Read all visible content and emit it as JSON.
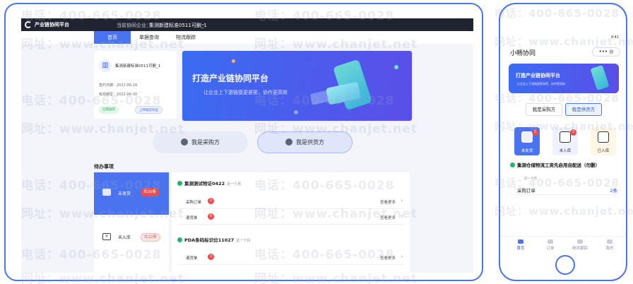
{
  "desktop": {
    "brand": "产业链协同平台",
    "enterprise_label": "当前协同企业：",
    "enterprise_value": "集测新建标准0511可删_1",
    "tabs": [
      "首页",
      "单据查询",
      "物流跟踪"
    ],
    "ent_card": {
      "name": "集测新建标准0511可删_1",
      "sign_date": "签约日期：2022-06-19",
      "expire_date": "有效期至：2022-06-30",
      "status_chip": "已配送货",
      "upload_chip": "上传收货凭证"
    },
    "banner": {
      "title": "打造产业链协同平台",
      "subtitle": "让企业上下游链接更紧密，协作更高效"
    },
    "roles": {
      "buyer": "我是采购方",
      "supplier": "我是供货方"
    },
    "todo": {
      "title": "待办事项",
      "tab_active": {
        "label": "未发货",
        "badge": "共20条"
      },
      "tab_inactive": {
        "label": "未入库",
        "badge": "共10条"
      },
      "groups": [
        {
          "title": "集测测试物证0422",
          "time": "近一个月",
          "rows": [
            {
              "label": "采购订单",
              "count": "2",
              "more": "查看更多"
            },
            {
              "label": "退货单",
              "count": "6",
              "more": "查看更多"
            }
          ]
        },
        {
          "title": "PDA条码标识位11027",
          "time": "近一个月",
          "rows": [
            {
              "label": "退货单",
              "count": "3",
              "more": "查看更多"
            }
          ]
        }
      ]
    }
  },
  "phone": {
    "time": "9:41",
    "title": "小畅协同",
    "menu": "••• ◎",
    "banner_title": "打造产业链协同平台",
    "banner_subtitle": "让企业上下游链接更紧密，协作更高效",
    "roles": {
      "buyer": "我是采购方",
      "supplier": "我是供货方"
    },
    "tiles": [
      {
        "label": "未发货",
        "badge": "2"
      },
      {
        "label": "未入库",
        "badge": "2"
      },
      {
        "label": "已入库"
      }
    ],
    "group_title": "集测仓储物流工资先启用自配送（勿删）",
    "group_time": "近一个月",
    "row_label": "采购订单",
    "row_value": "2条",
    "nav": [
      "首页",
      "订单",
      "物流跟踪",
      "我的"
    ]
  },
  "watermark": {
    "phone_line": "电话：400-665-0028",
    "url_line": "网址：www.chanjet.net"
  }
}
